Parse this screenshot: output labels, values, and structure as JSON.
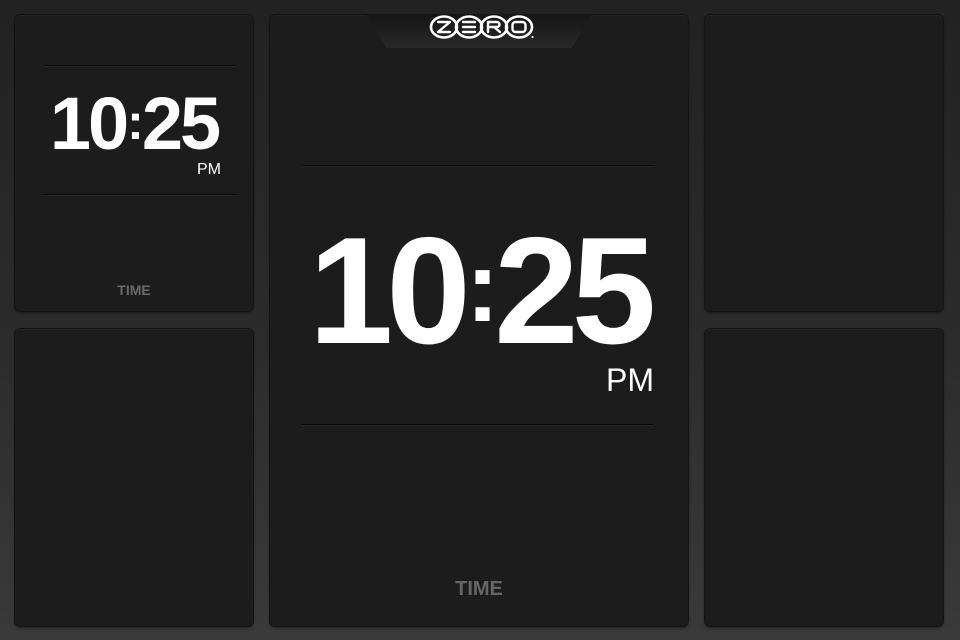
{
  "brand": {
    "logo_icon": "zero-logo-icon"
  },
  "small_widget": {
    "hours": "10",
    "separator": ":",
    "minutes": "25",
    "ampm": "PM",
    "label": "TIME"
  },
  "main_widget": {
    "hours": "10",
    "separator": ":",
    "minutes": "25",
    "ampm": "PM",
    "label": "TIME"
  },
  "colors": {
    "background": "#2a2a2a",
    "panel": "#1c1c1c",
    "clock_text": "#ffffff",
    "label_text": "#6a6a6a"
  }
}
